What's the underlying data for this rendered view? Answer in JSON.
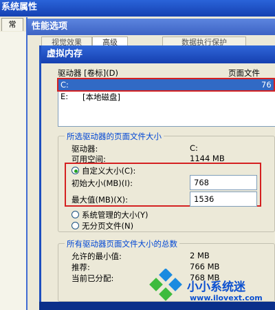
{
  "window_back": {
    "title": "系统属性",
    "tab": "常"
  },
  "window_mid": {
    "title": "性能选项",
    "tabs": [
      "视觉效果",
      "高级",
      "数据执行保护"
    ]
  },
  "dialog": {
    "title": "虚拟内存",
    "list_header_drive": "驱动器 [卷标](D)",
    "list_header_pagefile": "页面文件",
    "drives": [
      {
        "drive": "C:",
        "label": "",
        "size": "76"
      },
      {
        "drive": "E:",
        "label": "[本地磁盘]",
        "size": ""
      }
    ],
    "selected_group": {
      "title": "所选驱动器的页面文件大小",
      "drive_label": "驱动器:",
      "drive_value": "C:",
      "space_label": "可用空间:",
      "space_value": "1144 MB",
      "custom_size": "自定义大小(C):",
      "initial_label": "初始大小(MB)(I):",
      "initial_value": "768",
      "max_label": "最大值(MB)(X):",
      "max_value": "1536",
      "system_managed": "系统管理的大小(Y)",
      "no_pagefile": "无分页文件(N)"
    },
    "total_group": {
      "title": "所有驱动器页面文件大小的总数",
      "min_label": "允许的最小值:",
      "min_value": "2 MB",
      "recommended_label": "推荐:",
      "recommended_value": "766 MB",
      "allocated_label": "当前已分配:",
      "allocated_value": "768 MB"
    }
  },
  "watermark": {
    "brand": "小小系统迷",
    "url": "www.ilovext.com"
  },
  "colors": {
    "title_blue": "#1640b0",
    "selection": "#316ac5",
    "highlight_red": "#d42020",
    "group_label": "#0046d5"
  }
}
